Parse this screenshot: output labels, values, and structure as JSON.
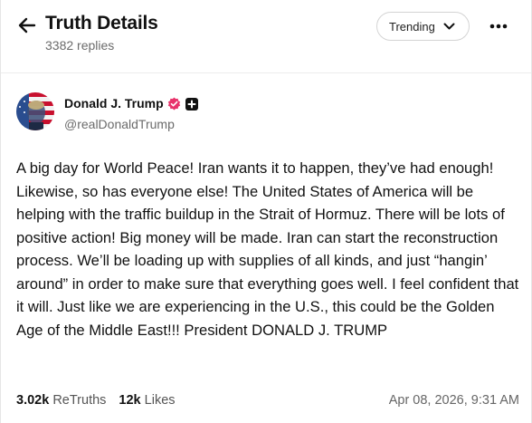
{
  "header": {
    "title": "Truth Details",
    "replies": "3382 replies",
    "sort_label": "Trending"
  },
  "icons": {
    "back": "arrow-left-icon",
    "sort": "chevron-down-icon",
    "more": "ellipsis-icon",
    "verified": "verified-badge-icon",
    "plus": "plus-badge-icon"
  },
  "post": {
    "author_name": "Donald J. Trump",
    "handle": "@realDonaldTrump",
    "text": "A big day for World Peace! Iran wants it to happen, they’ve had enough! Likewise, so has everyone else! The United States of America will be helping with the traffic buildup in the Strait of Hormuz. There will be lots of positive action! Big money will be made. Iran can start the reconstruction process. We’ll be loading up with supplies of all kinds, and just “hangin’ around” in order to make sure that everything goes well. I feel confident that it will. Just like we are experiencing in the U.S., this could be the Golden Age of the Middle East!!! President DONALD J. TRUMP",
    "retruths_count": "3.02k",
    "retruths_label": "ReTruths",
    "likes_count": "12k",
    "likes_label": "Likes",
    "timestamp": "Apr 08, 2026, 9:31 AM"
  },
  "colors": {
    "verified_badge": "#e8336b",
    "muted_text": "#6b6b6b",
    "divider": "#ececec"
  }
}
